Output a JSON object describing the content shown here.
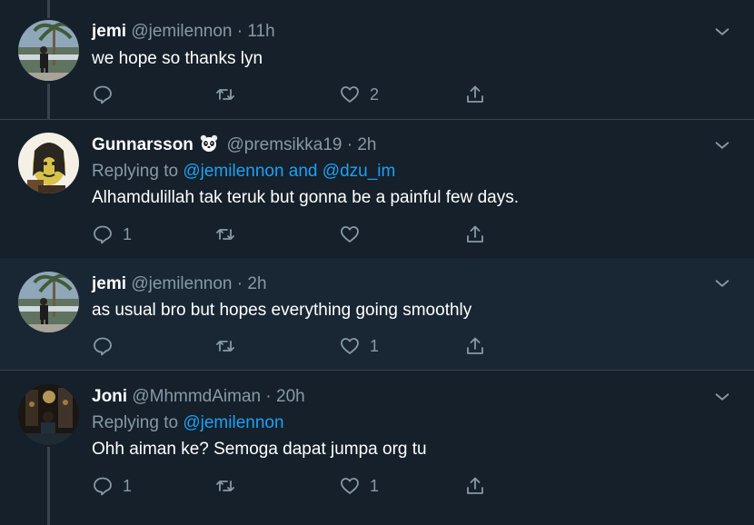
{
  "tweets": [
    {
      "name": "jemi",
      "handle": "@jemilennon",
      "separator": "·",
      "time": "11h",
      "text": "we hope so thanks lyn",
      "reply_count": "",
      "like_count": "2"
    },
    {
      "name": "Gunnarsson",
      "name_emoji": "panda-face-emoji",
      "handle": "@premsikka19",
      "separator": "·",
      "time": "2h",
      "replying_prefix": "Replying to ",
      "replying_to": "@jemilennon and @dzu_im",
      "text": "Alhamdulillah tak teruk but gonna be a painful few days.",
      "reply_count": "1",
      "like_count": ""
    },
    {
      "name": "jemi",
      "handle": "@jemilennon",
      "separator": "·",
      "time": "2h",
      "text": "as usual bro but hopes everything going smoothly",
      "reply_count": "",
      "like_count": "1"
    },
    {
      "name": "Joni",
      "handle": "@MhmmdAiman",
      "separator": "·",
      "time": "20h",
      "replying_prefix": "Replying to ",
      "replying_to": "@jemilennon",
      "text": "Ohh aiman ke? Semoga dapat jumpa org tu",
      "reply_count": "1",
      "like_count": "1"
    }
  ],
  "icons": {
    "reply": "reply-icon",
    "retweet": "retweet-icon",
    "like": "heart-icon",
    "share": "share-icon",
    "more": "chevron-down-icon"
  },
  "colors": {
    "background": "#15202b",
    "highlight": "#192734",
    "secondary_text": "#8899a6",
    "link": "#1da1f2",
    "divider": "#38444d"
  }
}
